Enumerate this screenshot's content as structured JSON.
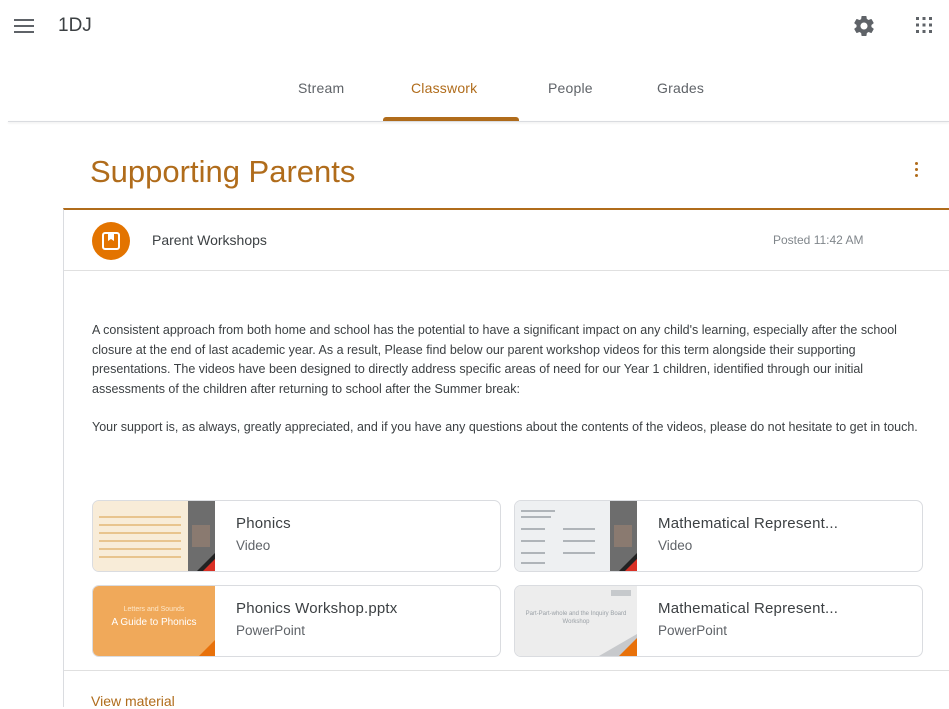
{
  "header": {
    "class_name": "1DJ"
  },
  "tabs": [
    {
      "label": "Stream"
    },
    {
      "label": "Classwork"
    },
    {
      "label": "People"
    },
    {
      "label": "Grades"
    }
  ],
  "active_tab": "Classwork",
  "topic": {
    "title": "Supporting Parents"
  },
  "material": {
    "title": "Parent Workshops",
    "posted": "Posted 11:42 AM",
    "description": [
      "A consistent approach from both home and school has the potential to have a significant impact on any child's learning, especially after the school closure at the end of last academic year. As a result, Please find below our parent workshop videos for this term alongside their supporting presentations. The videos have been designed to directly address specific areas of need for our Year 1 children, identified through our initial assessments of the children after returning to school after the Summer break:",
      "Your support is, as always, greatly appreciated, and if you have any questions about the contents of the videos, please do not hesitate to get in touch."
    ],
    "attachments": [
      {
        "name": "Phonics",
        "type": "Video",
        "thumb_text": ""
      },
      {
        "name": "Mathematical Represent...",
        "type": "Video",
        "thumb_text": ""
      },
      {
        "name": "Phonics Workshop.pptx",
        "type": "PowerPoint",
        "thumb_text": "A Guide to Phonics",
        "thumb_subtext": "Letters and Sounds"
      },
      {
        "name": "Mathematical Represent...",
        "type": "PowerPoint",
        "thumb_text": "Part-Part-whole and the Inquiry Board Workshop"
      }
    ],
    "view_label": "View material"
  },
  "colors": {
    "accent": "#b06c1b",
    "icon_bg": "#e37400"
  },
  "icons": [
    "menu-icon",
    "gear-icon",
    "apps-icon",
    "more-vert-icon",
    "material-icon"
  ]
}
